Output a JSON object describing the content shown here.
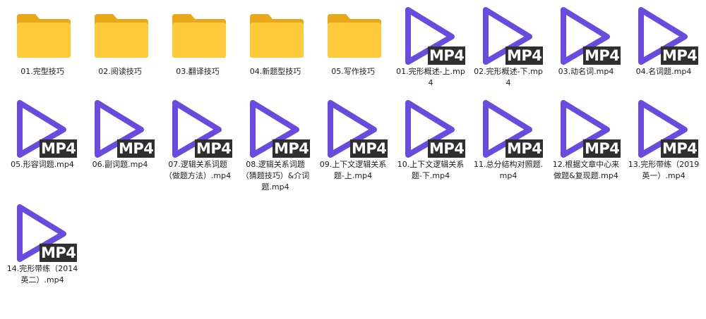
{
  "folders": [
    {
      "label": "01.完型技巧",
      "icon": "folder-icon"
    },
    {
      "label": "02.阅读技巧",
      "icon": "folder-icon"
    },
    {
      "label": "03.翻译技巧",
      "icon": "folder-icon"
    },
    {
      "label": "04.新题型技巧",
      "icon": "folder-icon"
    },
    {
      "label": "05.写作技巧",
      "icon": "folder-icon"
    }
  ],
  "videos": [
    {
      "label": "01.完形概述-上.mp4",
      "badge": "MP4",
      "icon": "mp4-video-icon"
    },
    {
      "label": "02.完形概述-下.mp4",
      "badge": "MP4",
      "icon": "mp4-video-icon"
    },
    {
      "label": "03.动名词.mp4",
      "badge": "MP4",
      "icon": "mp4-video-icon"
    },
    {
      "label": "04.名词题.mp4",
      "badge": "MP4",
      "icon": "mp4-video-icon"
    },
    {
      "label": "05.形容词题.mp4",
      "badge": "MP4",
      "icon": "mp4-video-icon"
    },
    {
      "label": "06.副词题.mp4",
      "badge": "MP4",
      "icon": "mp4-video-icon"
    },
    {
      "label": "07.逻辑关系词题（做题方法）.mp4",
      "badge": "MP4",
      "icon": "mp4-video-icon"
    },
    {
      "label": "08.逻辑关系词题（猜题技巧）&介词题.mp4",
      "badge": "MP4",
      "icon": "mp4-video-icon"
    },
    {
      "label": "09.上下文逻辑关系题-上.mp4",
      "badge": "MP4",
      "icon": "mp4-video-icon"
    },
    {
      "label": "10.上下文逻辑关系题-下.mp4",
      "badge": "MP4",
      "icon": "mp4-video-icon"
    },
    {
      "label": "11.总分结构对照题.mp4",
      "badge": "MP4",
      "icon": "mp4-video-icon"
    },
    {
      "label": "12.根据文章中心来做题&复现题.mp4",
      "badge": "MP4",
      "icon": "mp4-video-icon"
    },
    {
      "label": "13.完形带练（2019英一）.mp4",
      "badge": "MP4",
      "icon": "mp4-video-icon"
    },
    {
      "label": "14.完形带练（2014英二）.mp4",
      "badge": "MP4",
      "icon": "mp4-video-icon"
    }
  ],
  "colors": {
    "folder_back": "#E9A81A",
    "folder_front": "#FFCB3D",
    "play": "#6A4BE0",
    "badge_bg": "#2F2F2F"
  }
}
